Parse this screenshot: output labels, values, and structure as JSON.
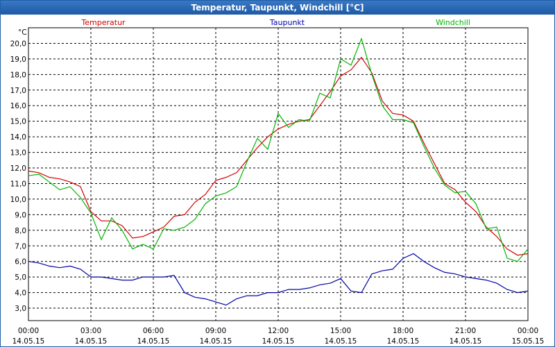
{
  "window": {
    "title": "Temperatur, Taupunkt, Windchill [°C]"
  },
  "chart_data": {
    "type": "line",
    "title": "Temperatur, Taupunkt, Windchill [°C]",
    "ylabel": "°C",
    "ylim": [
      2.2,
      21.0
    ],
    "xlim": [
      "14.05.15 00:00",
      "15.05.15 00:00"
    ],
    "grid": true,
    "legend_placement": "top",
    "y_ticks": [
      "3,0",
      "4,0",
      "5,0",
      "6,0",
      "7,0",
      "8,0",
      "9,0",
      "10,0",
      "11,0",
      "12,0",
      "13,0",
      "14,0",
      "15,0",
      "16,0",
      "17,0",
      "18,0",
      "19,0",
      "20,0"
    ],
    "x_ticks": [
      {
        "time": "00:00",
        "date": "14.05.15"
      },
      {
        "time": "03:00",
        "date": "14.05.15"
      },
      {
        "time": "06:00",
        "date": "14.05.15"
      },
      {
        "time": "09:00",
        "date": "14.05.15"
      },
      {
        "time": "12:00",
        "date": "14.05.15"
      },
      {
        "time": "15:00",
        "date": "14.05.15"
      },
      {
        "time": "18:00",
        "date": "14.05.15"
      },
      {
        "time": "21:00",
        "date": "14.05.15"
      },
      {
        "time": "00:00",
        "date": "15.05.15"
      }
    ],
    "x_hours": [
      0,
      0.5,
      1,
      1.5,
      2,
      2.5,
      3,
      3.5,
      4,
      4.5,
      5,
      5.5,
      6,
      6.5,
      7,
      7.5,
      8,
      8.5,
      9,
      9.5,
      10,
      10.5,
      11,
      11.5,
      12,
      12.5,
      13,
      13.5,
      14,
      14.5,
      15,
      15.5,
      16,
      16.5,
      17,
      17.5,
      18,
      18.5,
      19,
      19.5,
      20,
      20.5,
      21,
      21.5,
      22,
      22.5,
      23,
      23.5,
      24
    ],
    "series": [
      {
        "name": "Temperatur",
        "color": "#d00000",
        "values": [
          11.8,
          11.7,
          11.4,
          11.3,
          11.1,
          10.8,
          9.2,
          8.6,
          8.6,
          8.3,
          7.5,
          7.6,
          7.9,
          8.2,
          8.9,
          9.0,
          9.8,
          10.3,
          11.2,
          11.4,
          11.7,
          12.5,
          13.3,
          14.0,
          14.5,
          14.8,
          15.0,
          15.1,
          16.0,
          16.9,
          17.9,
          18.3,
          19.1,
          18.1,
          16.3,
          15.5,
          15.4,
          15.0,
          13.6,
          12.3,
          11.0,
          10.6,
          9.8,
          9.2,
          8.2,
          7.6,
          6.8,
          6.4,
          6.5
        ]
      },
      {
        "name": "Taupunkt",
        "color": "#0000aa",
        "values": [
          6.0,
          5.9,
          5.7,
          5.6,
          5.7,
          5.5,
          5.0,
          5.0,
          4.9,
          4.8,
          4.8,
          5.0,
          5.0,
          5.0,
          5.1,
          4.0,
          3.7,
          3.6,
          3.4,
          3.2,
          3.6,
          3.8,
          3.8,
          4.0,
          4.0,
          4.2,
          4.2,
          4.3,
          4.5,
          4.6,
          4.9,
          4.1,
          4.0,
          5.2,
          5.4,
          5.5,
          6.2,
          6.5,
          6.0,
          5.6,
          5.3,
          5.2,
          5.0,
          4.9,
          4.8,
          4.6,
          4.2,
          4.0,
          4.1
        ]
      },
      {
        "name": "Windchill",
        "color": "#00b400",
        "values": [
          11.5,
          11.6,
          11.1,
          10.6,
          10.8,
          10.1,
          9.1,
          7.4,
          8.8,
          8.0,
          6.8,
          7.1,
          6.8,
          8.1,
          8.0,
          8.2,
          8.7,
          9.7,
          10.2,
          10.4,
          10.8,
          12.4,
          13.9,
          13.2,
          15.5,
          14.6,
          15.1,
          15.0,
          16.8,
          16.5,
          19.0,
          18.6,
          20.3,
          18.0,
          16.0,
          15.1,
          15.1,
          14.9,
          13.4,
          12.0,
          10.9,
          10.4,
          10.5,
          9.7,
          8.1,
          8.2,
          6.2,
          6.0,
          6.8
        ]
      }
    ]
  }
}
